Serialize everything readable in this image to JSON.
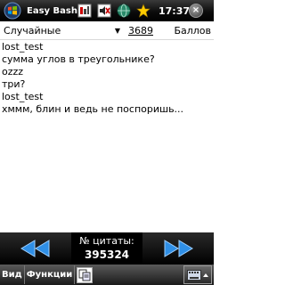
{
  "titlebar": {
    "app_title": "Easy Bash",
    "clock": "17:37",
    "close_label": "×",
    "icons": [
      "start-windows-icon",
      "connectivity-icon",
      "mute-speaker-icon",
      "network-globe-icon",
      "star-icon"
    ]
  },
  "filter": {
    "category_value": "Случайные",
    "quote_count": "3689",
    "score_label": "Баллов"
  },
  "quote": {
    "lines": [
      "lost_test",
      "сумма углов в треугольнике?",
      "ozzz",
      "три?",
      "lost_test",
      "хммм, блин и ведь не поспоришь..."
    ]
  },
  "nav": {
    "quote_number_label": "№ цитаты:",
    "quote_number_value": "395324",
    "prev_icon": "double-left-arrow-icon",
    "next_icon": "double-right-arrow-icon"
  },
  "menubar": {
    "view_label": "Вид",
    "functions_label": "Функции",
    "copy_icon": "copy-icon",
    "keyboard_icon": "keyboard-icon"
  },
  "colors": {
    "arrow_blue": "#2f8fe6",
    "bar_black": "#000000"
  }
}
